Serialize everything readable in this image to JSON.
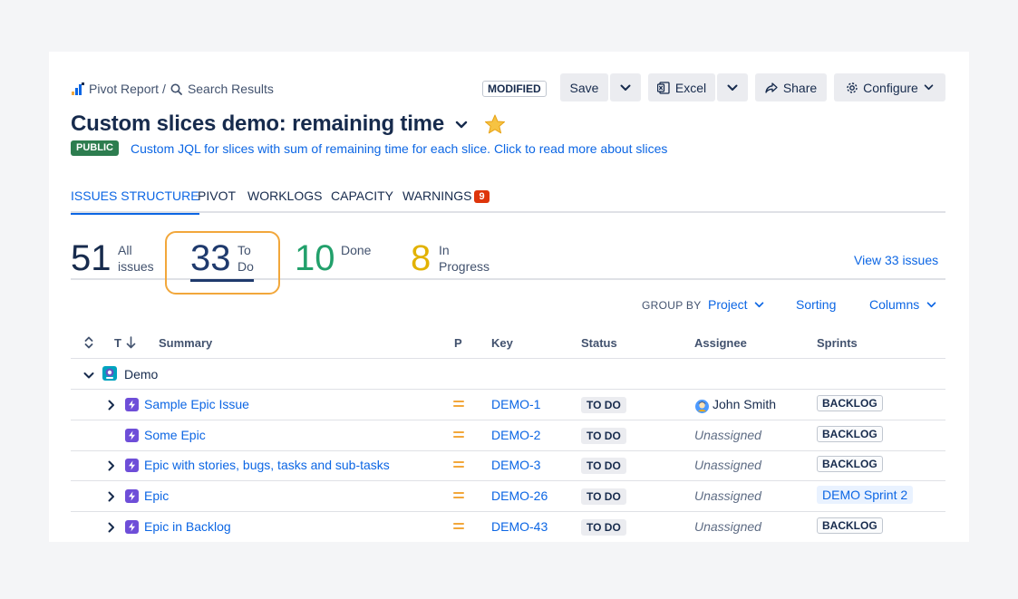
{
  "breadcrumb": {
    "pivot": "Pivot Report",
    "separator": "/",
    "search": "Search Results"
  },
  "toolbar": {
    "modified": "MODIFIED",
    "save": "Save",
    "excel": "Excel",
    "share": "Share",
    "configure": "Configure"
  },
  "report": {
    "title": "Custom slices demo: remaining time",
    "visibility": "PUBLIC",
    "description": "Custom JQL for slices with sum of remaining time for each slice. Click to read more about slices",
    "starred": true
  },
  "tabs": [
    {
      "label": "ISSUES STRUCTURE",
      "active": true
    },
    {
      "label": "PIVOT"
    },
    {
      "label": "WORKLOGS"
    },
    {
      "label": "CAPACITY"
    },
    {
      "label": "WARNINGS",
      "count": "9"
    }
  ],
  "stats": [
    {
      "value": "51",
      "label1": "All",
      "label2": "issues",
      "color": "#172b4d"
    },
    {
      "value": "33",
      "label1": "To",
      "label2": "Do",
      "color": "#1f3a6d",
      "selected": true
    },
    {
      "value": "10",
      "label1": "Done",
      "label2": "",
      "color": "#22a06b"
    },
    {
      "value": "8",
      "label1": "In",
      "label2": "Progress",
      "color": "#e2b203"
    }
  ],
  "view_link": "View 33 issues",
  "controls": {
    "group_by_label": "GROUP BY",
    "group_by_value": "Project",
    "sorting": "Sorting",
    "columns": "Columns"
  },
  "table": {
    "headers": {
      "type": "T",
      "summary": "Summary",
      "priority": "P",
      "key": "Key",
      "status": "Status",
      "assignee": "Assignee",
      "sprints": "Sprints"
    },
    "group": {
      "name": "Demo"
    },
    "rows": [
      {
        "summary": "Sample Epic Issue",
        "key": "DEMO-1",
        "status": "TO DO",
        "assignee": "John Smith",
        "sprint": "BACKLOG",
        "expandable": true,
        "has_avatar": true
      },
      {
        "summary": "Some Epic",
        "key": "DEMO-2",
        "status": "TO DO",
        "assignee": "Unassigned",
        "sprint": "BACKLOG",
        "expandable": false
      },
      {
        "summary": "Epic with stories, bugs, tasks and sub-tasks",
        "key": "DEMO-3",
        "status": "TO DO",
        "assignee": "Unassigned",
        "sprint": "BACKLOG",
        "expandable": true
      },
      {
        "summary": "Epic",
        "key": "DEMO-26",
        "status": "TO DO",
        "assignee": "Unassigned",
        "sprint": "DEMO Sprint 2",
        "sprint_style": "active",
        "expandable": true
      },
      {
        "summary": "Epic in Backlog",
        "key": "DEMO-43",
        "status": "TO DO",
        "assignee": "Unassigned",
        "sprint": "BACKLOG",
        "expandable": true
      }
    ]
  },
  "colors": {
    "link": "#0c66e4",
    "epic": "#6e4ed8",
    "priority_medium": "#f2a73b",
    "todo_highlight": "#f2a73b",
    "public": "#2d7d4f",
    "warning": "#de350b"
  }
}
